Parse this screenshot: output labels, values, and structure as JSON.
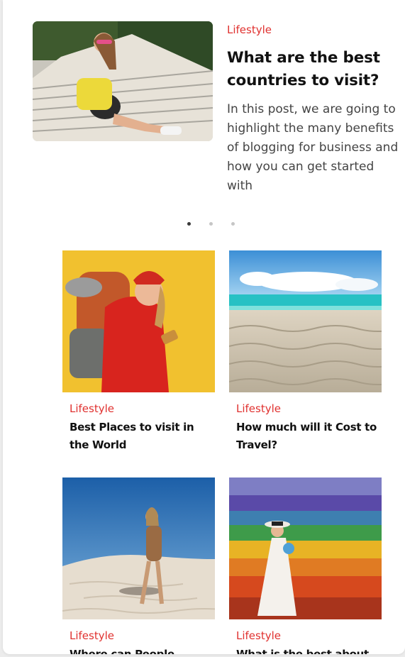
{
  "featured": {
    "category": "Lifestyle",
    "title": "What are the best countries to visit?",
    "excerpt": "In this post, we are going to highlight the many benefits of blogging for business and how you can get started with"
  },
  "carousel": {
    "pages": 3,
    "active": 1
  },
  "posts": [
    {
      "category": "Lifestyle",
      "title": "Best Places to visit in the World"
    },
    {
      "category": "Lifestyle",
      "title": "How much will it Cost to Travel?"
    },
    {
      "category": "Lifestyle",
      "title": "Where can People"
    },
    {
      "category": "Lifestyle",
      "title": "What is the best about"
    }
  ],
  "colors": {
    "accent": "#e0312f",
    "title": "#111111",
    "text": "#444444"
  }
}
